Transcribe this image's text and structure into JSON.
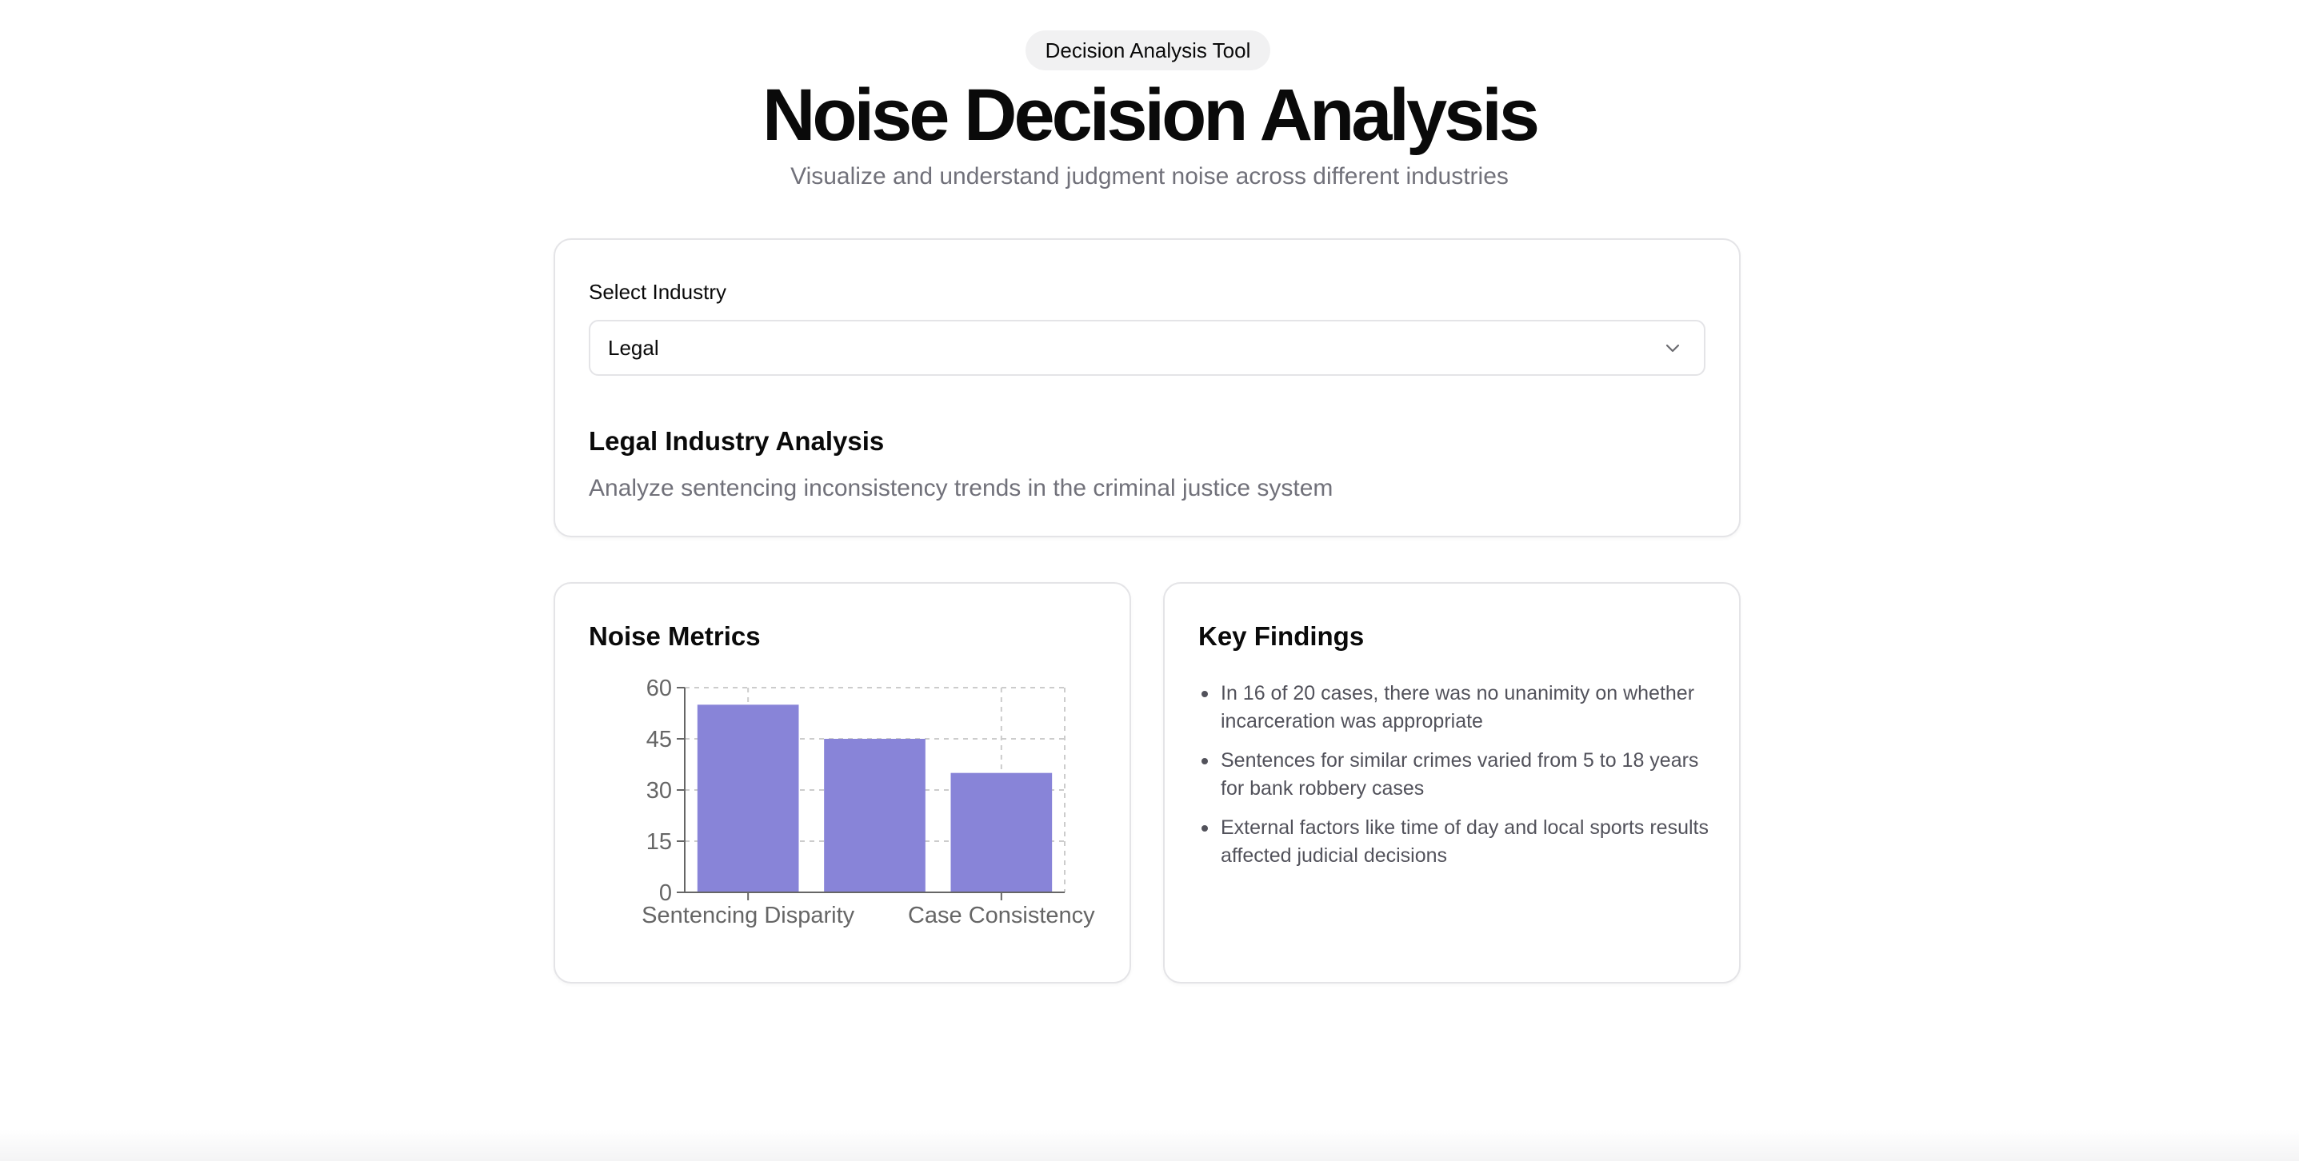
{
  "header": {
    "badge": "Decision Analysis Tool",
    "title": "Noise Decision Analysis",
    "subtitle": "Visualize and understand judgment noise across different industries"
  },
  "industry_select": {
    "label": "Select Industry",
    "value": "Legal"
  },
  "analysis": {
    "heading": "Legal Industry Analysis",
    "description": "Analyze sentencing inconsistency trends in the criminal justice system"
  },
  "metrics": {
    "heading": "Noise Metrics"
  },
  "findings": {
    "heading": "Key Findings",
    "items": [
      "In 16 of 20 cases, there was no unanimity on whether incarceration was appropriate",
      "Sentences for similar crimes varied from 5 to 18 years for bank robbery cases",
      "External factors like time of day and local sports results affected judicial decisions"
    ]
  },
  "colors": {
    "bar": "#8884d8",
    "grid": "#cccccc",
    "axis": "#666666"
  },
  "chart_data": {
    "type": "bar",
    "categories": [
      "Sentencing Disparity",
      "",
      "Case Consistency"
    ],
    "values": [
      55,
      45,
      35
    ],
    "yticks": [
      0,
      15,
      30,
      45,
      60
    ],
    "ylim": [
      0,
      60
    ],
    "grid": true
  }
}
